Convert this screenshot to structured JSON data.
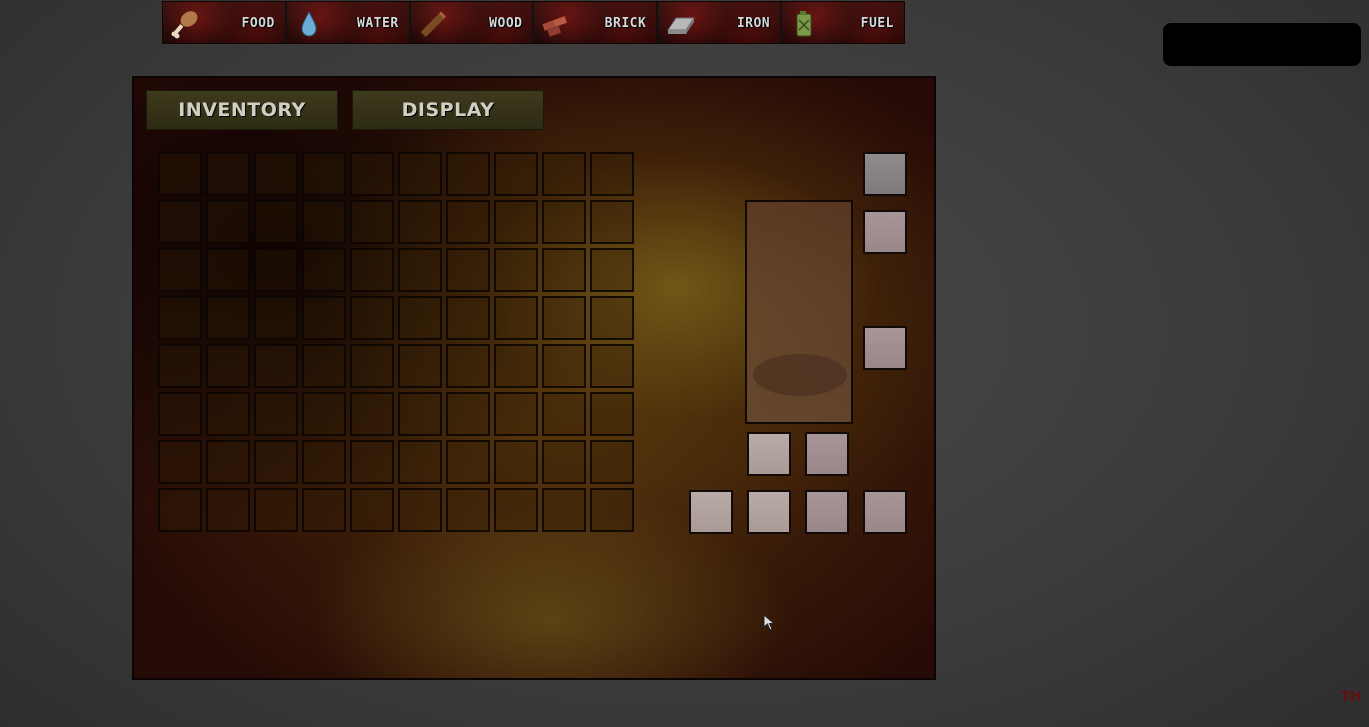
{
  "resources": [
    {
      "label": "FOOD",
      "icon": "drumstick-icon"
    },
    {
      "label": "WATER",
      "icon": "water-drop-icon"
    },
    {
      "label": "WOOD",
      "icon": "wood-plank-icon"
    },
    {
      "label": "BRICK",
      "icon": "brick-icon"
    },
    {
      "label": "IRON",
      "icon": "iron-ingot-icon"
    },
    {
      "label": "FUEL",
      "icon": "fuel-canister-icon"
    }
  ],
  "panel": {
    "inventory_tab": "INVENTORY",
    "display_tab": "DISPLAY"
  },
  "inventory": {
    "columns": 10,
    "rows": 8
  },
  "corner_text": "TH",
  "colors": {
    "panel_dark": "#260a06",
    "panel_glow": "#5c3a0e",
    "slot_fill": "#a89598",
    "resource_red": "#3a1210"
  }
}
